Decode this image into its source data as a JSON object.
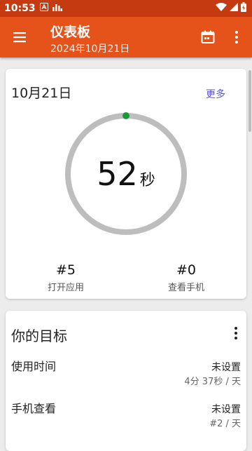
{
  "status_bar": {
    "time": "10:53",
    "icons": [
      "notification-a-icon",
      "signal-bars-icon",
      "wifi-icon",
      "cell-signal-icon",
      "battery-icon"
    ]
  },
  "app_bar": {
    "title": "仪表板",
    "subtitle": "2024年10月21日",
    "color": "#e6531a",
    "status_color": "#c53a10"
  },
  "summary": {
    "date": "10月21日",
    "more_label": "更多",
    "ring_value": "52",
    "ring_unit": "秒",
    "ring_progress": 0,
    "stats": [
      {
        "value": "#5",
        "label": "打开应用"
      },
      {
        "value": "#0",
        "label": "查看手机"
      }
    ]
  },
  "goals": {
    "title": "你的目标",
    "items": [
      {
        "name": "使用时间",
        "status": "未设置",
        "detail": "4分 37秒 / 天"
      },
      {
        "name": "手机查看",
        "status": "未设置",
        "detail": "#2 / 天"
      }
    ]
  },
  "colors": {
    "accent_link": "#5a54d6",
    "ring_track": "#bdbdbd",
    "ring_dot": "#1a9a3a"
  }
}
